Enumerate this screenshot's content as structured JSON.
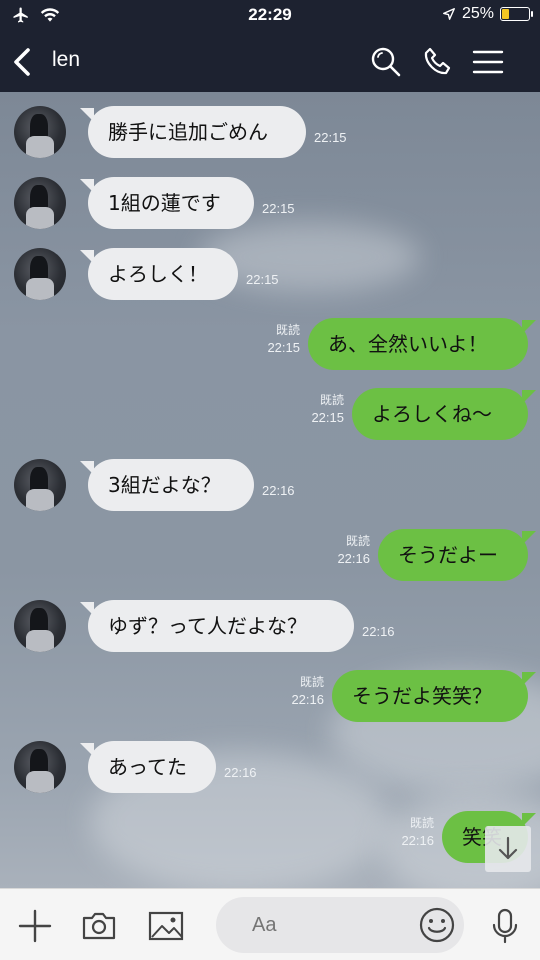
{
  "status": {
    "time": "22:29",
    "battery": "25%",
    "battery_level": 0.25
  },
  "header": {
    "title": "len"
  },
  "messages": [
    {
      "side": "in",
      "text": "勝手に追加ごめん",
      "time": "22:15"
    },
    {
      "side": "in",
      "text": "1組の蓮です",
      "time": "22:15"
    },
    {
      "side": "in",
      "text": "よろしく！",
      "time": "22:15"
    },
    {
      "side": "out",
      "text": "あ、全然いいよ！",
      "time": "22:15",
      "read": "既読"
    },
    {
      "side": "out",
      "text": "よろしくね〜",
      "time": "22:15",
      "read": "既読"
    },
    {
      "side": "in",
      "text": "3組だよな？",
      "time": "22:16"
    },
    {
      "side": "out",
      "text": "そうだよー",
      "time": "22:16",
      "read": "既読"
    },
    {
      "side": "in",
      "text": "ゆず？って人だよな？",
      "time": "22:16"
    },
    {
      "side": "out",
      "text": "そうだよ笑笑？",
      "time": "22:16",
      "read": "既読"
    },
    {
      "side": "in",
      "text": "あってた",
      "time": "22:16"
    },
    {
      "side": "out",
      "text": "笑笑",
      "time": "22:16",
      "read": "既読"
    }
  ],
  "input": {
    "placeholder": "Aa"
  },
  "icons": {
    "status": [
      "airplane-icon",
      "wifi-icon",
      "location-arrow-icon",
      "battery-icon"
    ],
    "header": [
      "back-chevron-icon",
      "search-icon",
      "phone-icon",
      "menu-icon"
    ],
    "bar": [
      "plus-icon",
      "camera-icon",
      "image-icon",
      "emoji-icon",
      "microphone-icon"
    ],
    "scroll": "arrow-down-icon"
  },
  "colors": {
    "outgoing": "#6cc044",
    "incoming": "#ecedef",
    "header": "#1d2230",
    "battery": "#f3c623"
  }
}
